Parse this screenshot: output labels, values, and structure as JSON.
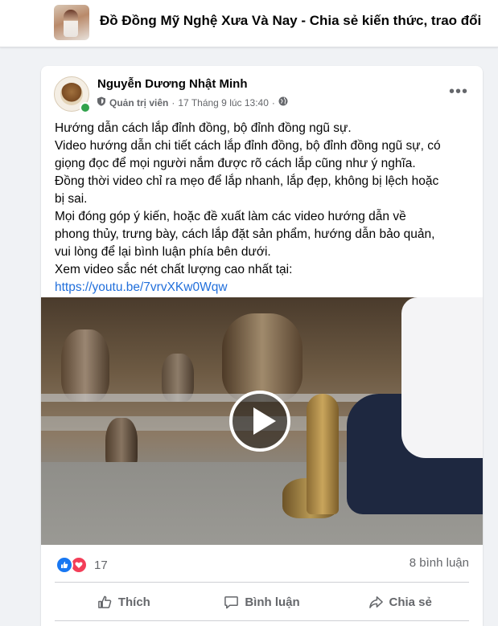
{
  "group": {
    "title": "Đồ Đồng Mỹ Nghệ Xưa Và Nay - Chia sẻ kiến thức, trao đổi"
  },
  "post": {
    "author": "Nguyễn Dương Nhật Minh",
    "role": "Quản trị viên",
    "separator": "·",
    "timestamp": "17 Tháng 9 lúc 13:40",
    "more_label": "•••",
    "lines": [
      "Hướng dẫn cách lắp đỉnh đồng, bộ đỉnh đồng ngũ sự.",
      "Video hướng dẫn chi tiết cách lắp đỉnh đồng, bộ đỉnh đồng ngũ sự, có",
      "giọng đọc để mọi người nắm được rõ cách lắp cũng như ý nghĩa.",
      "Đồng thời video chỉ ra mẹo để lắp nhanh, lắp đẹp, không bị lệch hoặc",
      "bị sai.",
      "Mọi đóng góp ý kiến, hoặc đề xuất làm các video hướng dẫn về",
      "phong thủy, trưng bày, cách lắp đặt sản phẩm, hướng dẫn bảo quản,",
      "vui lòng để lại bình luận phía bên dưới.",
      "Xem video sắc nét chất lượng cao nhất tại:"
    ],
    "link": "https://youtu.be/7vrvXKw0Wqw"
  },
  "stats": {
    "reaction_count": "17",
    "comments": "8 bình luận",
    "reactions": [
      "like-icon",
      "love-icon"
    ]
  },
  "actions": {
    "like": "Thích",
    "comment": "Bình luận",
    "share": "Chia sẻ"
  },
  "colors": {
    "accent": "#1877f2",
    "link": "#216fdb",
    "love": "#f33e58",
    "online": "#31a24c",
    "muted": "#65676b"
  }
}
